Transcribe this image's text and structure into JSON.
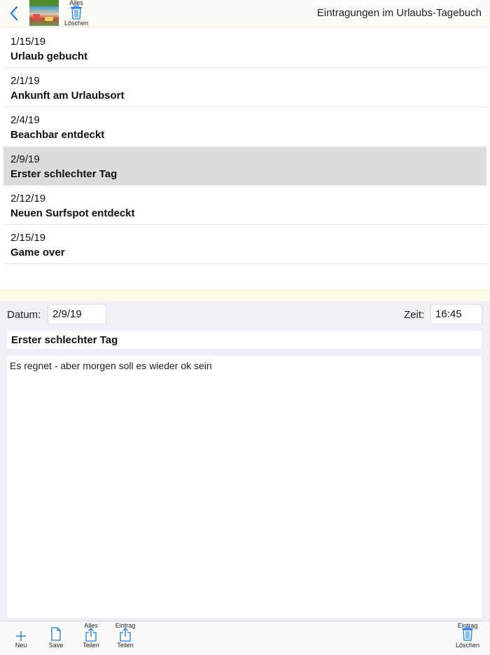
{
  "header": {
    "title": "Eintragungen im Urlaubs-Tagebuch",
    "delete_all_top": "Alles",
    "delete_all_bottom": "Löschen"
  },
  "entries": [
    {
      "date": "1/15/19",
      "title": "Urlaub gebucht"
    },
    {
      "date": "2/1/19",
      "title": "Ankunft am Urlaubsort"
    },
    {
      "date": "2/4/19",
      "title": "Beachbar entdeckt"
    },
    {
      "date": "2/9/19",
      "title": "Erster schlechter Tag",
      "selected": true
    },
    {
      "date": "2/12/19",
      "title": "Neuen Surfspot entdeckt"
    },
    {
      "date": "2/15/19",
      "title": "Game over"
    }
  ],
  "detail": {
    "date_label": "Datum:",
    "date_value": "2/9/19",
    "time_label": "Zeit:",
    "time_value": "16:45",
    "entry_title": "Erster schlechter Tag",
    "entry_text": "Es regnet - aber morgen soll es wieder ok sein"
  },
  "toolbar": {
    "new_label": "Neu",
    "save_label": "Save",
    "share_all_top": "Alles",
    "share_all_bottom": "Teilen",
    "share_entry_top": "Eintrag",
    "share_entry_bottom": "Teilen",
    "delete_entry_top": "Eintrag",
    "delete_entry_bottom": "Löschen"
  },
  "colors": {
    "accent": "#1a7cf5",
    "selected_row": "#dcdcdc",
    "detail_background": "#efeff4"
  },
  "icons": [
    "back-chevron-icon",
    "trash-icon",
    "plus-icon",
    "document-icon",
    "share-icon"
  ]
}
